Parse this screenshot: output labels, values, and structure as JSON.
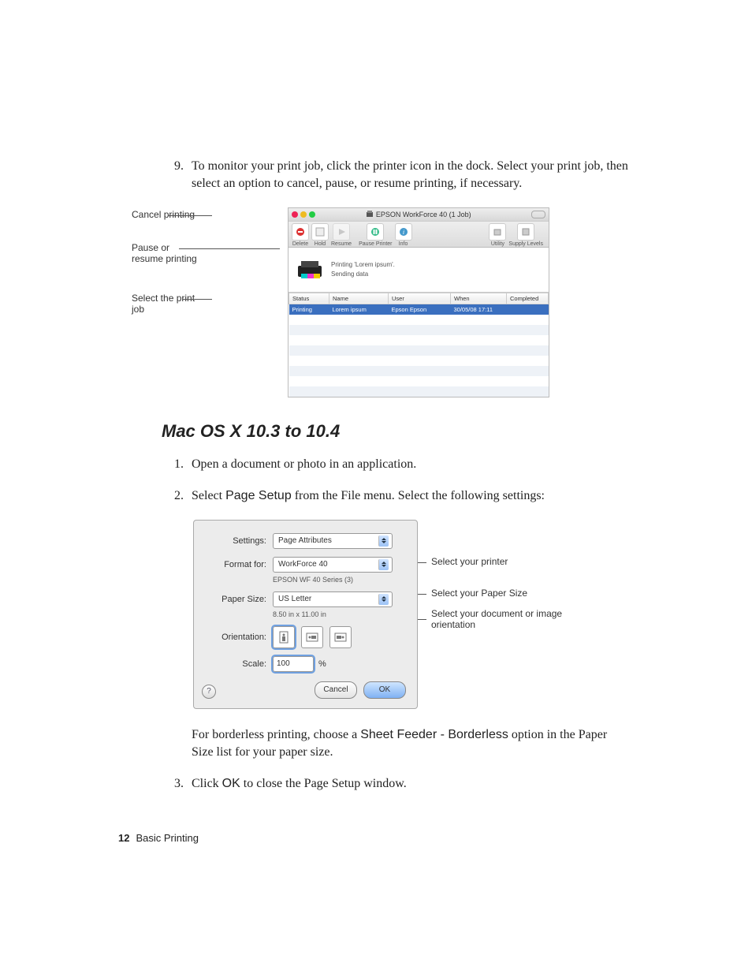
{
  "step9": {
    "num": "9.",
    "text": "To monitor your print job, click the printer icon in the dock. Select your print job, then select an option to cancel, pause, or resume printing, if necessary."
  },
  "fig1": {
    "callouts": {
      "cancel": "Cancel printing",
      "pause": "Pause or resume printing",
      "select": "Select the print job"
    },
    "window_title": "EPSON WorkForce 40 (1 Job)",
    "toolbar": {
      "delete": "Delete",
      "hold": "Hold",
      "resume": "Resume",
      "pause": "Pause Printer",
      "info": "Info",
      "utility": "Utility",
      "supply": "Supply Levels"
    },
    "status": {
      "line1": "Printing 'Lorem ipsum'.",
      "line2": "Sending data"
    },
    "table": {
      "headers": {
        "status": "Status",
        "name": "Name",
        "user": "User",
        "when": "When",
        "completed": "Completed"
      },
      "row": {
        "status": "Printing",
        "name": "Lorem ipsum",
        "user": "Epson Epson",
        "when": "30/05/08 17:11",
        "completed": ""
      }
    }
  },
  "section_title": "Mac OS X 10.3 to 10.4",
  "step1": {
    "num": "1.",
    "text": "Open a document or photo in an application."
  },
  "step2": {
    "num": "2.",
    "pre": "Select ",
    "bold": "Page Setup",
    "post": " from the File menu. Select the following settings:"
  },
  "dlg": {
    "labels": {
      "settings": "Settings:",
      "format": "Format for:",
      "paper": "Paper Size:",
      "orientation": "Orientation:",
      "scale": "Scale:"
    },
    "values": {
      "settings": "Page Attributes",
      "format": "WorkForce 40",
      "format_sub": "EPSON WF 40 Series (3)",
      "paper": "US Letter",
      "paper_sub": "8.50 in x 11.00 in",
      "scale": "100",
      "scale_unit": "%"
    },
    "buttons": {
      "cancel": "Cancel",
      "ok": "OK"
    },
    "help": "?"
  },
  "fig2_callouts": {
    "printer": "Select your printer",
    "paper_pre": "Select your ",
    "paper_bold": "Paper Size",
    "orient": "Select your document or image orientation"
  },
  "after_fig2": {
    "pre": "For borderless printing, choose a ",
    "bold": "Sheet Feeder - Borderless",
    "post": " option in the Paper Size list for your paper size."
  },
  "step3": {
    "num": "3.",
    "pre": "Click ",
    "bold": "OK",
    "post": " to close the Page Setup window."
  },
  "footer": {
    "page": "12",
    "section": "Basic Printing"
  }
}
